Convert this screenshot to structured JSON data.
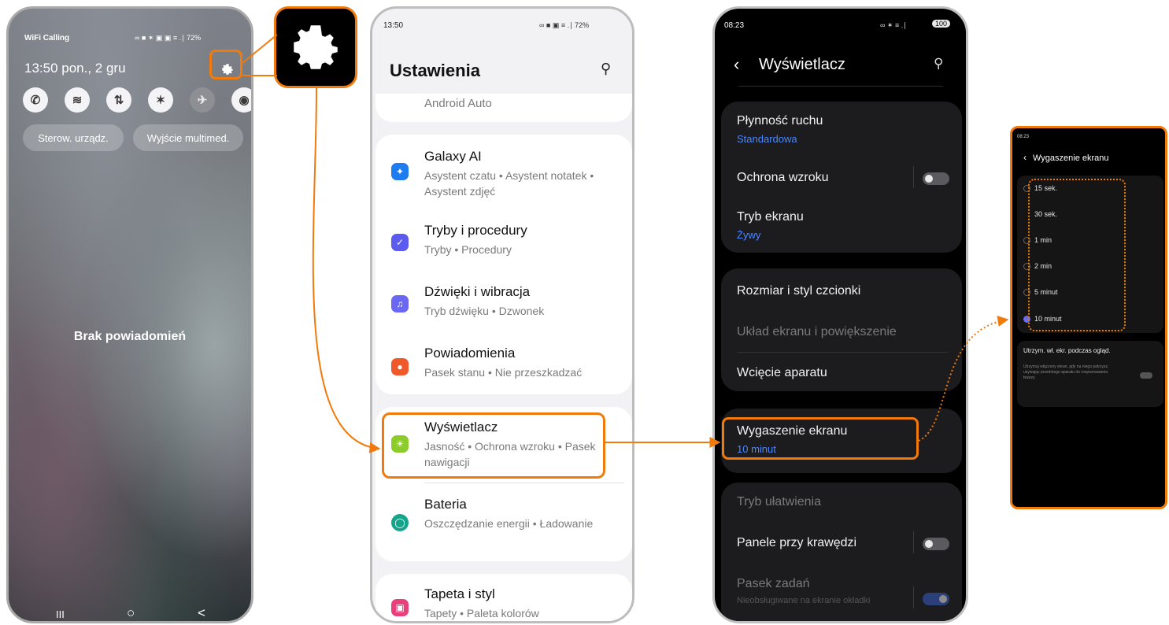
{
  "panel1": {
    "carrier": "WiFi Calling",
    "status_icons": "∞ ■ ✶ ▣ ▣ ≡ .∣ 72%",
    "datetime": "13:50 pon., 2 gru",
    "pill_left": "Sterow. urządz.",
    "pill_right": "Wyjście multimed.",
    "empty_text": "Brak powiadomień",
    "nav_recent": "III",
    "nav_home": "○",
    "nav_back": "<"
  },
  "panel2": {
    "time": "13:50",
    "status": "∞ ■ ▣ ≡ .∣ 72%",
    "title": "Ustawienia",
    "partial_item": "Android Auto",
    "items": [
      {
        "title": "Galaxy AI",
        "sub": "Asystent czatu • Asystent notatek • Asystent zdjęć",
        "color": "#1f7cf0"
      },
      {
        "title": "Tryby i procedury",
        "sub": "Tryby • Procedury",
        "color": "#5b5bf0"
      },
      {
        "title": "Dźwięki i wibracja",
        "sub": "Tryb dźwięku • Dzwonek",
        "color": "#6a68f2"
      },
      {
        "title": "Powiadomienia",
        "sub": "Pasek stanu • Nie przeszkadzać",
        "color": "#f05a2a"
      },
      {
        "title": "Wyświetlacz",
        "sub": "Jasność • Ochrona wzroku • Pasek nawigacji",
        "color": "#8ccc2a"
      },
      {
        "title": "Bateria",
        "sub": "Oszczędzanie energii • Ładowanie",
        "color": "#16a58a"
      },
      {
        "title": "Tapeta i styl",
        "sub": "Tapety • Paleta kolorów",
        "color": "#e8407a"
      }
    ]
  },
  "panel3": {
    "time": "08:23",
    "status": "∞ ✶ ≡ .∣",
    "battery": "100",
    "title": "Wyświetlacz",
    "motion": "Płynność ruchu",
    "motion_value": "Standardowa",
    "eye": "Ochrona wzroku",
    "mode": "Tryb ekranu",
    "mode_value": "Żywy",
    "font": "Rozmiar i styl czcionki",
    "layout": "Układ ekranu i powiększenie",
    "camera": "Wcięcie aparatu",
    "timeout": "Wygaszenie ekranu",
    "timeout_value": "10 minut",
    "easy": "Tryb ułatwienia",
    "edge": "Panele przy krawędzi",
    "taskbar": "Pasek zadań",
    "taskbar_sub": "Nieobsługiwane na ekranie okładki"
  },
  "panel4": {
    "time": "08:23",
    "title": "Wygaszenie ekranu",
    "options": [
      "15 sek.",
      "30 sek.",
      "1 min",
      "2 min",
      "5 minut",
      "10 minut"
    ],
    "selected": "10 minut",
    "keep_title": "Utrzym. wł. ekr. podczas ogląd.",
    "keep_sub": "Utrzymuj włączony ekran, gdy na niego patrzysz, używając przedniego aparatu do rozpoznawania twarzy."
  },
  "colors": {
    "accent": "#f07b0c",
    "link_blue": "#4b86ff"
  }
}
